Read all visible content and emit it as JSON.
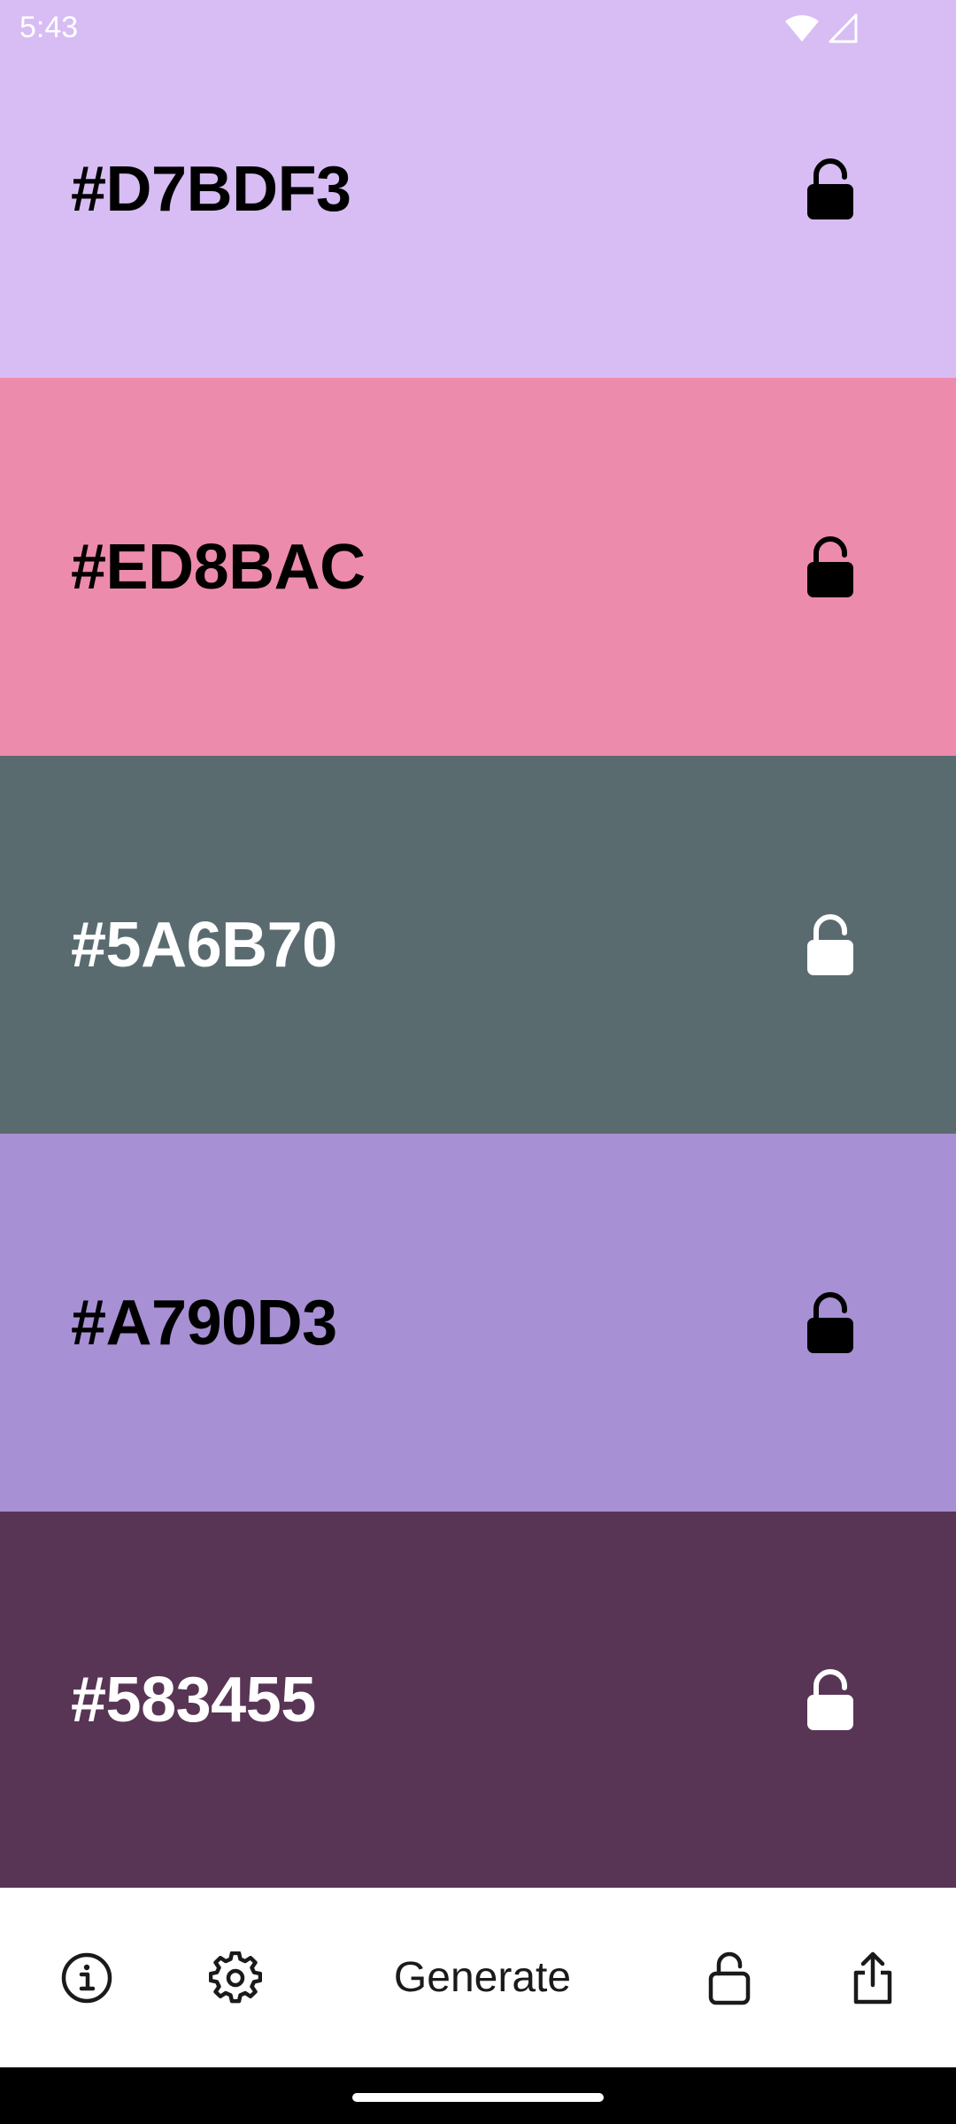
{
  "status_bar": {
    "time": "5:43",
    "icons": [
      "wifi-icon",
      "cell-signal-icon"
    ]
  },
  "swatches": [
    {
      "hex": "#D7BDF3",
      "color": "#D7BDF3",
      "text_color": "#000000",
      "lock_icon": "unlocked-icon",
      "locked": false
    },
    {
      "hex": "#ED8BAC",
      "color": "#ED8BAC",
      "text_color": "#000000",
      "lock_icon": "unlocked-icon",
      "locked": false
    },
    {
      "hex": "#5A6B70",
      "color": "#5A6B70",
      "text_color": "#FFFFFF",
      "lock_icon": "unlocked-icon",
      "locked": false
    },
    {
      "hex": "#A790D3",
      "color": "#A790D3",
      "text_color": "#000000",
      "lock_icon": "unlocked-icon",
      "locked": false
    },
    {
      "hex": "#583455",
      "color": "#583455",
      "text_color": "#FFFFFF",
      "lock_icon": "unlocked-icon",
      "locked": false
    }
  ],
  "toolbar": {
    "info_icon": "info-icon",
    "settings_icon": "gear-icon",
    "generate_label": "Generate",
    "lock_all_icon": "unlocked-icon",
    "share_icon": "share-icon"
  },
  "colors": {
    "toolbar_bg": "#FFFFFF",
    "nav_bar_bg": "#000000"
  }
}
